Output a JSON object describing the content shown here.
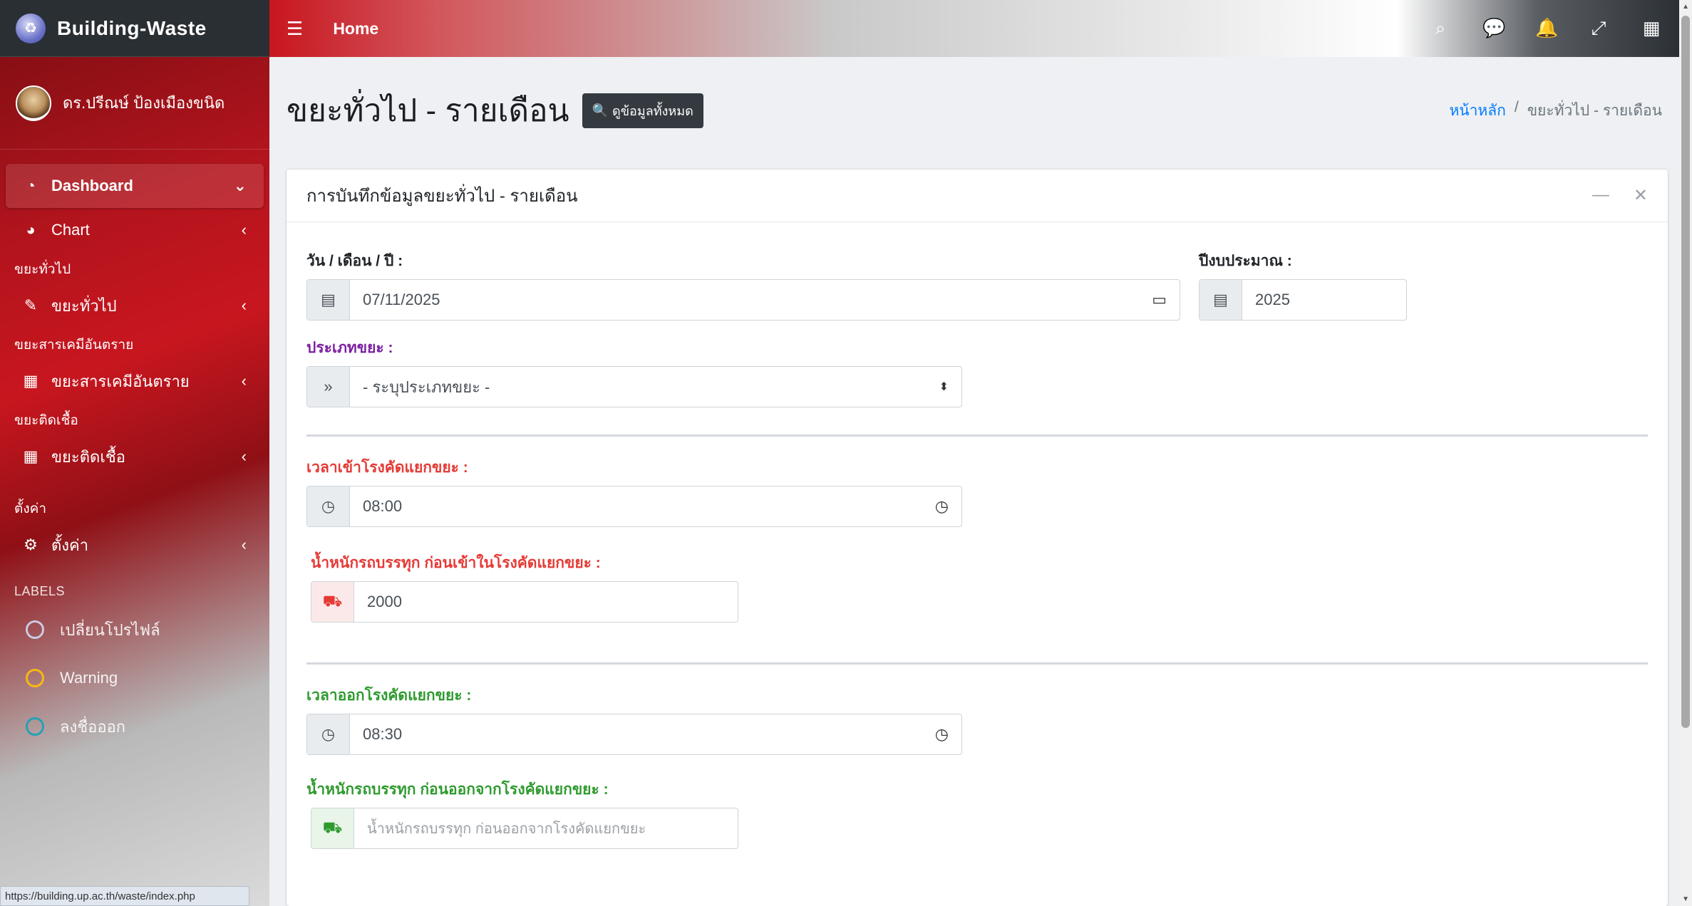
{
  "sidebar": {
    "brand": "Building-Waste",
    "user_name": "ดร.ปรีณษ์ ป้องเมืองขนิด",
    "items": [
      {
        "label": "Dashboard",
        "icon": "dashboard-icon"
      },
      {
        "label": "Chart",
        "icon": "pie-chart-icon"
      },
      {
        "header": "ขยะทั่วไป"
      },
      {
        "label": "ขยะทั่วไป",
        "icon": "edit-icon"
      },
      {
        "header": "ขยะสารเคมีอันตราย"
      },
      {
        "label": "ขยะสารเคมีอันตราย",
        "icon": "table-icon"
      },
      {
        "header": "ขยะติดเชื้อ"
      },
      {
        "label": "ขยะติดเชื้อ",
        "icon": "table-icon"
      },
      {
        "header": "ตั้งค่า"
      },
      {
        "label": "ตั้งค่า",
        "icon": "cogs-icon"
      }
    ],
    "labels_header": "LABELS",
    "labels": [
      {
        "label": "เปลี่ยนโปรไฟล์",
        "color": "#cfd8f0"
      },
      {
        "label": "Warning",
        "color": "#ffc107"
      },
      {
        "label": "ลงชื่อออก",
        "color": "#17a2b8"
      }
    ],
    "status_url": "https://building.up.ac.th/waste/index.php"
  },
  "topnav": {
    "home": "Home"
  },
  "header": {
    "title": "ขยะทั่วไป - รายเดือน",
    "all_button": "ดูข้อมูลทั้งหมด",
    "breadcrumb_home": "หน้าหลัก",
    "breadcrumb_sep": "/",
    "breadcrumb_current": "ขยะทั่วไป - รายเดือน"
  },
  "card": {
    "title": "การบันทึกข้อมูลขยะทั่วไป - รายเดือน"
  },
  "form": {
    "date_label": "วัน / เดือน / ปี :",
    "date_value": "07/11/2025",
    "fiscal_label": "ปีงบประมาณ :",
    "fiscal_value": "2025",
    "type_label": "ประเภทขยะ :",
    "type_value": "- ระบุประเภทขยะ -",
    "entry_time_label": "เวลาเข้าโรงคัดแยกขยะ :",
    "entry_time_value": "08:00",
    "entry_weight_label": "น้ำหนักรถบรรทุก ก่อนเข้าในโรงคัดแยกขยะ :",
    "entry_weight_value": "2000",
    "exit_time_label": "เวลาออกโรงคัดแยกขยะ :",
    "exit_time_value": "08:30",
    "exit_weight_label": "น้ำหนักรถบรรทุก ก่อนออกจากโรงคัดแยกขยะ :",
    "exit_weight_placeholder": "น้ำหนักรถบรรทุก ก่อนออกจากโรงคัดแยกขยะ"
  },
  "colors": {
    "type_label": "#7b1fa2",
    "entry_label": "#e53935",
    "exit_label": "#2e9a2e"
  }
}
